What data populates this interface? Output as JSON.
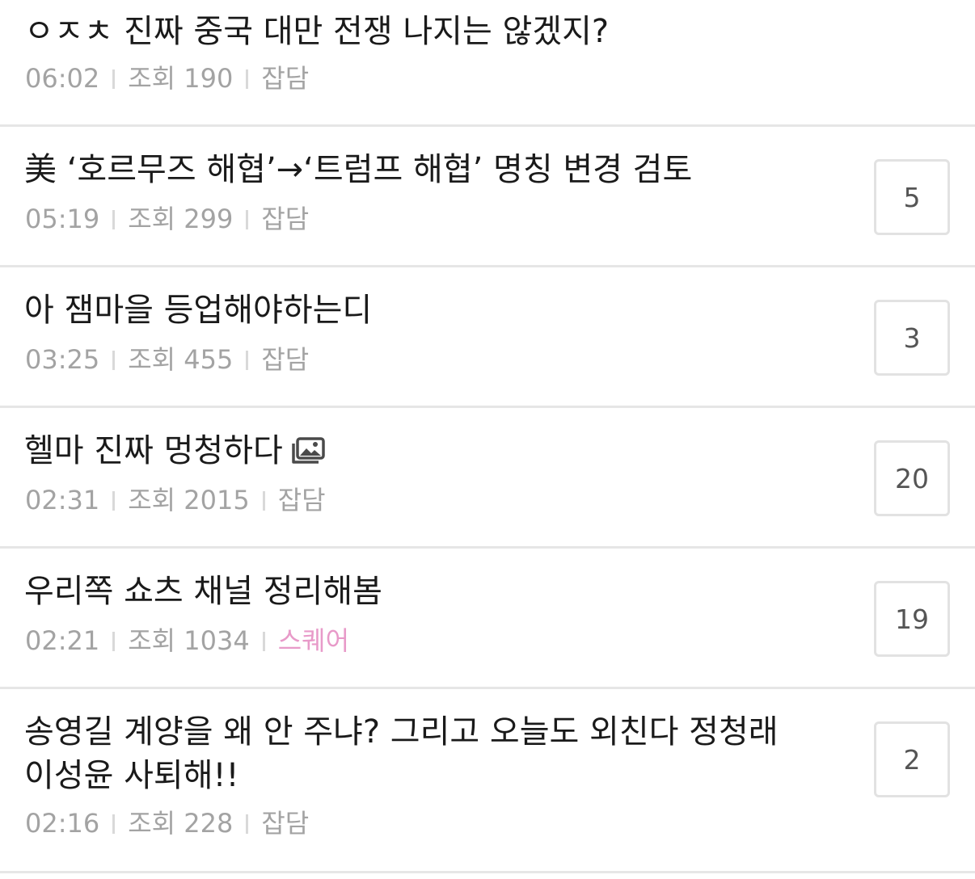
{
  "labels": {
    "views_prefix": "조회"
  },
  "colors": {
    "title": "#1a1a1a",
    "meta": "#a3a3a3",
    "category_default": "#a3a3a3",
    "category_square": "#e89ac9",
    "divider": "#e6e6e6",
    "comment_border": "#e2e2e2"
  },
  "posts": [
    {
      "title": "ㅇㅈㅊ 진짜 중국 대만 전쟁 나지는 않겠지?",
      "time": "06:02",
      "views": "190",
      "category": "잡담",
      "comments": null,
      "has_image_icon": false
    },
    {
      "title": "美 ‘호르무즈 해협’→‘트럼프 해협’ 명칭 변경 검토",
      "time": "05:19",
      "views": "299",
      "category": "잡담",
      "comments": "5",
      "has_image_icon": false
    },
    {
      "title": "아 잼마을 등업해야하는디",
      "time": "03:25",
      "views": "455",
      "category": "잡담",
      "comments": "3",
      "has_image_icon": false
    },
    {
      "title": "헬마 진짜 멍청하다",
      "time": "02:31",
      "views": "2015",
      "category": "잡담",
      "comments": "20",
      "has_image_icon": true,
      "icon": "image-gallery-icon"
    },
    {
      "title": "우리쪽 쇼츠 채널 정리해봄",
      "time": "02:21",
      "views": "1034",
      "category": "스퀘어",
      "comments": "19",
      "has_image_icon": false
    },
    {
      "title": "송영길 계양을 왜 안 주냐? 그리고 오늘도 외친다 정청래 이성윤 사퇴해!!",
      "time": "02:16",
      "views": "228",
      "category": "잡담",
      "comments": "2",
      "has_image_icon": false
    }
  ]
}
